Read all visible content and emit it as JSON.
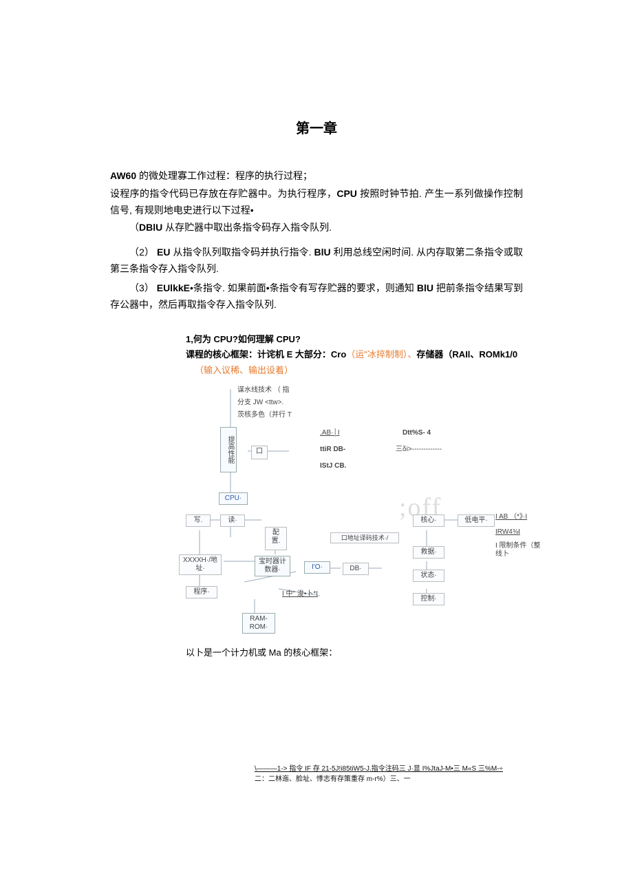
{
  "chapter_title": "第一章",
  "intro": {
    "line1_bold": "AW60",
    "line1_rest": " 的微处理寡工作过程：程序的执行过程；",
    "line2a": "设程序的指令代码已存放在存贮器中。为执行程序，",
    "line2_bold": "CPU",
    "line2b": " 按照时钟节拍. 产生一系列做操作控制信号, 有规则地电史进行以下过程•",
    "item1a": "（",
    "item1_bold": "DBlU",
    "item1b": " 从存贮器中取出条指令码存入指令队列.",
    "item2a": "（2） ",
    "item2_bold1": "EU",
    "item2b": " 从指令队列取指令码并执行指令. ",
    "item2_bold2": "BlU",
    "item2c": " 利用总线空闲时间. 从内存取第二条指令或取第三条指令存入指令队列.",
    "item3a": "（3） ",
    "item3_bold1": "EUlkkE",
    "item3b": "•条指令. 如果前面•条指令有写存贮器的要求，则通知 ",
    "item3_bold2": "BlU",
    "item3c": " 把前条指令结果写到存公器中，然后再取指令存入指令队列."
  },
  "section2": {
    "q": "1,何为 CPU?如何理解 CPU?",
    "framework_a": "课程的核心框架：计诧机 E 大部分：Cro",
    "framework_orange1": "（运\"冰捽制制）、",
    "framework_b": "存储器（RAIl、ROMk1/0",
    "framework_orange2": "（输入议稀、输出设着）"
  },
  "diagram": {
    "flow1": "谋水线技术 （ 指",
    "flow2": "分支 JW <ttw>.",
    "flow3": "茨核多色（并行 T",
    "perfbox": "提高性能",
    "smallbox": "口",
    "ab_label": ".AB·│I",
    "db_label": "ttiR DB-",
    "cb_label": "IStJ CB.",
    "dtt_label": "Dtt%S- 4",
    "tri_label": "三δi>-------------",
    "cpu": "CPU·",
    "write": "写.",
    "read": "读·",
    "xxxxh": "XXXXH·/地址·",
    "program": "程序·",
    "config": "配置.",
    "timer": "宝时器计数器·",
    "io": "I'O·",
    "db2": "DB·",
    "ramrom": "RAM-ROM·",
    "mid_label": "I 中\" 浚•卜*I",
    "addr_decode": "口地址译码技术·/",
    "core": "核心·",
    "data": "救据·",
    "status": "状态·",
    "control": "控制·",
    "lowlevel": "低电平·",
    "iab": "I AB （*》·I",
    "rw": "IRW4⅜I",
    "limit": "I 限制条件（整线卜",
    "watermark": ";off",
    "summary": "以卜是一个计力机或 Ma 的核心框架："
  },
  "footnote": {
    "line1": "\\———1-> 指令 IF 存 21-5J!i85tiW5-J.指令注码三 J·显 I%JtaJ-M•三 M«S 三%M-÷",
    "line2": "二：二林迤、脸址、悸志有存策重存 m-r%）三、一"
  }
}
